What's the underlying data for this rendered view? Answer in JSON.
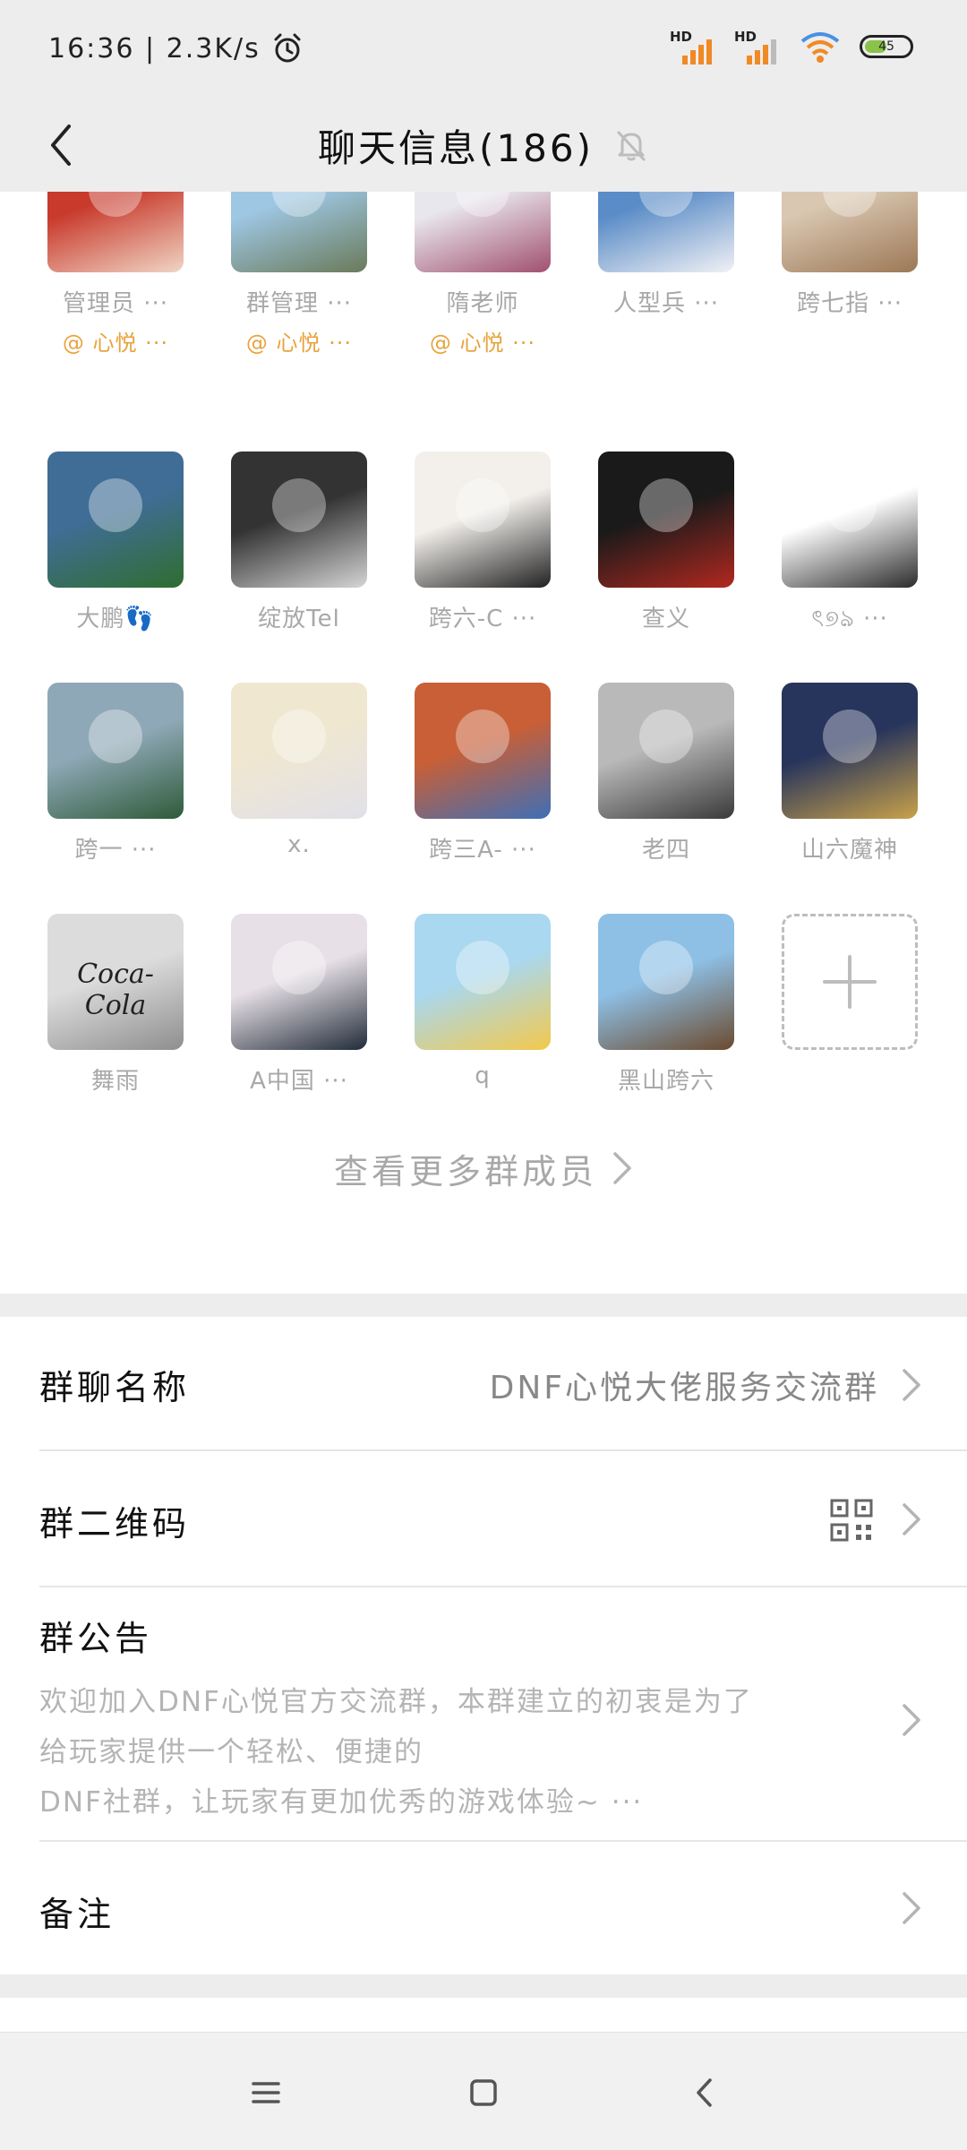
{
  "status_bar": {
    "time_speed": "16:36 | 2.3K/s",
    "signal_badge_1": "HD",
    "signal_badge_2": "HD",
    "battery_level": "45"
  },
  "header": {
    "title": "聊天信息(186)"
  },
  "members": [
    {
      "name": "管理员 ···",
      "tag": "@ 心悦 ···",
      "colors": [
        "#c83a2c",
        "#f0d5c5"
      ]
    },
    {
      "name": "群管理 ···",
      "tag": "@ 心悦 ···",
      "colors": [
        "#9ec7e3",
        "#6a7a5a"
      ]
    },
    {
      "name": "隋老师",
      "tag": "@ 心悦 ···",
      "colors": [
        "#e9e7ee",
        "#a0506e"
      ]
    },
    {
      "name": "人型兵 ···",
      "tag": "",
      "colors": [
        "#5a8cc7",
        "#f1f1f5"
      ]
    },
    {
      "name": "跨七指 ···",
      "tag": "",
      "colors": [
        "#d9c7b1",
        "#9c7856"
      ]
    },
    {
      "name": "大鹏👣",
      "tag": "",
      "colors": [
        "#3f6d95",
        "#2f6d30"
      ]
    },
    {
      "name": "绽放Tel",
      "tag": "",
      "colors": [
        "#333333",
        "#d5d5d5"
      ]
    },
    {
      "name": "跨六-C ···",
      "tag": "",
      "colors": [
        "#f3f0ec",
        "#222222"
      ]
    },
    {
      "name": "查义",
      "tag": "",
      "colors": [
        "#1a1a1a",
        "#b2281f"
      ]
    },
    {
      "name": "ৎ୭ঌ ···",
      "tag": "",
      "colors": [
        "#ffffff",
        "#2c2c2c"
      ]
    },
    {
      "name": "跨一 ···",
      "tag": "",
      "colors": [
        "#8fa8b7",
        "#2e5b39"
      ]
    },
    {
      "name": "x.",
      "tag": "",
      "colors": [
        "#f0e7d1",
        "#e0e0e8"
      ]
    },
    {
      "name": "跨三A- ···",
      "tag": "",
      "colors": [
        "#c85f36",
        "#3e6fb6"
      ]
    },
    {
      "name": "老四",
      "tag": "",
      "colors": [
        "#b9b9b9",
        "#3a3a3a"
      ]
    },
    {
      "name": "山六魔神",
      "tag": "",
      "colors": [
        "#27345c",
        "#c9a24a"
      ]
    },
    {
      "name": "舞雨",
      "tag": "",
      "colors": [
        "#dcdcdc",
        "#8e8e8e"
      ],
      "logo": "Coca-Cola"
    },
    {
      "name": "A中国 ···",
      "tag": "",
      "colors": [
        "#e7e0e6",
        "#222c3a"
      ]
    },
    {
      "name": "q",
      "tag": "",
      "colors": [
        "#a9d8f0",
        "#f2c94c"
      ]
    },
    {
      "name": "黑山跨六",
      "tag": "",
      "colors": [
        "#8ec0e6",
        "#6b4a2e"
      ]
    }
  ],
  "view_more": {
    "label": "查看更多群成员"
  },
  "settings": {
    "group_name": {
      "label": "群聊名称",
      "value": "DNF心悦大佬服务交流群"
    },
    "qr_code": {
      "label": "群二维码"
    },
    "notice": {
      "label": "群公告",
      "line1": "欢迎加入DNF心悦官方交流群，本群建立的初衷是为了",
      "line2": "给玩家提供一个轻松、便捷的",
      "line3": "DNF社群，让玩家有更加优秀的游戏体验~ ···"
    },
    "remark": {
      "label": "备注"
    }
  },
  "accent_colors": {
    "tag_orange": "#e8a33d",
    "signal_orange": "#f08a24"
  }
}
